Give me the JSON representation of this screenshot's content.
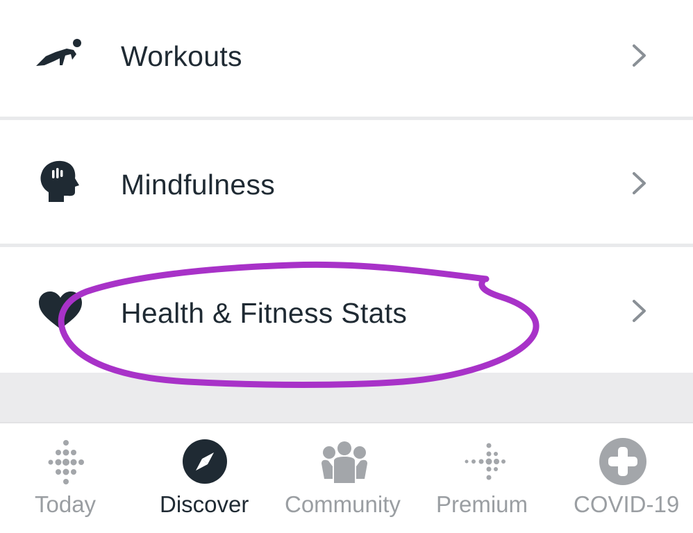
{
  "menu": {
    "items": [
      {
        "label": "Workouts",
        "icon": "workout-icon"
      },
      {
        "label": "Mindfulness",
        "icon": "mindfulness-head-icon"
      },
      {
        "label": "Health & Fitness Stats",
        "icon": "heart-icon"
      }
    ]
  },
  "nav": {
    "items": [
      {
        "label": "Today",
        "icon": "fitbit-dots-icon",
        "active": false
      },
      {
        "label": "Discover",
        "icon": "compass-icon",
        "active": true
      },
      {
        "label": "Community",
        "icon": "community-icon",
        "active": false
      },
      {
        "label": "Premium",
        "icon": "premium-dots-icon",
        "active": false
      },
      {
        "label": "COVID-19",
        "icon": "covid-plus-icon",
        "active": false
      }
    ]
  },
  "colors": {
    "text_primary": "#1f2a33",
    "text_inactive": "#9a9ea2",
    "icon_dark": "#1f2a33",
    "icon_inactive": "#a3a6aa",
    "chevron": "#8a9096",
    "annotation": "#a832c8",
    "divider": "#e9eaec"
  }
}
